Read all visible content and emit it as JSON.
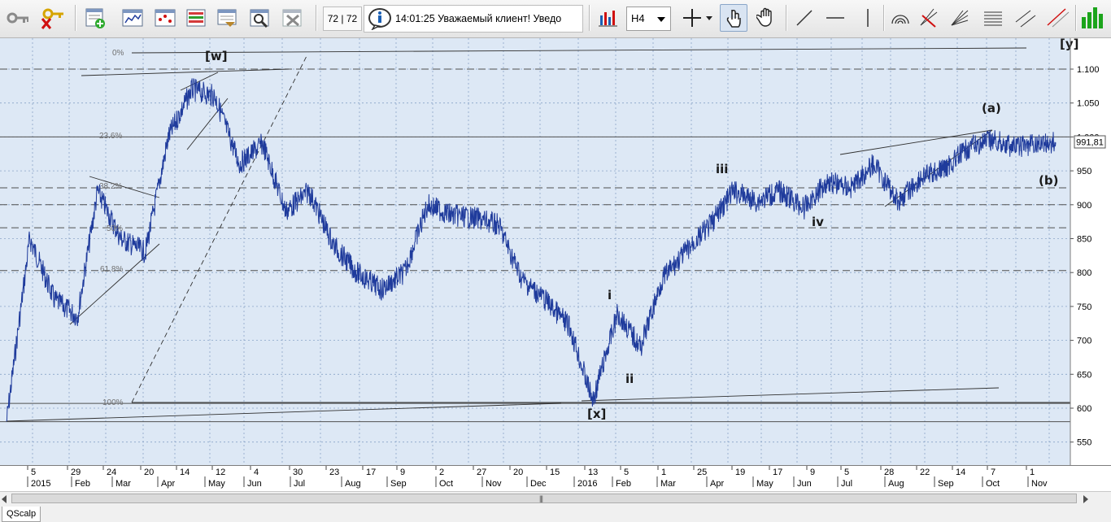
{
  "toolbar": {
    "counter": "72 | 72",
    "ticker": "14:01:25  Уважаемый клиент!  Уведо",
    "timeframe": "H4",
    "icons": [
      "key-icon",
      "key-delete-icon",
      "add-chart-icon",
      "bars-icon",
      "chart-points-icon",
      "table-icon",
      "deal-icon",
      "search-edit-icon",
      "remove-icon",
      "info-icon",
      "indicator-icon",
      "crosshair-icon",
      "hand-pointer-icon",
      "hand-drag-icon",
      "trend-line-icon",
      "horizontal-line-icon",
      "vertical-line-icon",
      "arc-icon",
      "pitchfork-icon",
      "fan-icon",
      "fibo-levels-icon",
      "channel-icon",
      "volume-bars-icon"
    ]
  },
  "chart": {
    "price_label": "991,81",
    "y_ticks": [
      "1.100",
      "1.050",
      "1.000",
      "950",
      "900",
      "850",
      "800",
      "750",
      "700",
      "650",
      "600",
      "550"
    ],
    "fib_labels": [
      "0%",
      "23.6%",
      "38.2%",
      "50%",
      "61.8%",
      "100%"
    ],
    "wave_labels": [
      "[w]",
      "[x]",
      "[y]",
      "(a)",
      "(b)",
      "i",
      "ii",
      "iii",
      "iv"
    ],
    "day_labels": [
      "5",
      "29",
      "24",
      "20",
      "14",
      "12",
      "4",
      "30",
      "23",
      "17",
      "9",
      "2",
      "27",
      "20",
      "15",
      "13",
      "5",
      "1",
      "25",
      "19",
      "17",
      "9",
      "5",
      "28",
      "22",
      "14",
      "7",
      "1"
    ],
    "month_labels": [
      "2015",
      "Feb",
      "Mar",
      "Apr",
      "May",
      "Jun",
      "Jul",
      "Aug",
      "Sep",
      "Oct",
      "Nov",
      "Dec",
      "2016",
      "Feb",
      "Mar",
      "Apr",
      "May",
      "Jun",
      "Jul",
      "Aug",
      "Sep",
      "Oct",
      "Nov"
    ],
    "colors": {
      "background": "#dde8f5",
      "series": "#1f3b9c",
      "grid": "#8aa4c8",
      "levels": "#555555"
    }
  },
  "chart_data": {
    "type": "line",
    "title": "",
    "timeframe": "H4",
    "ylim": [
      525,
      1130
    ],
    "last_value": 991.81,
    "x": [
      "2015-01-05",
      "2015-01-20",
      "2015-02-05",
      "2015-02-20",
      "2015-03-05",
      "2015-03-20",
      "2015-04-05",
      "2015-04-20",
      "2015-05-05",
      "2015-05-20",
      "2015-06-05",
      "2015-06-20",
      "2015-07-05",
      "2015-07-20",
      "2015-08-05",
      "2015-08-20",
      "2015-09-05",
      "2015-09-20",
      "2015-10-05",
      "2015-10-20",
      "2015-11-05",
      "2015-11-20",
      "2015-12-05",
      "2015-12-20",
      "2016-01-05",
      "2016-01-20",
      "2016-02-05",
      "2016-02-20",
      "2016-03-05",
      "2016-03-20",
      "2016-04-05",
      "2016-04-20",
      "2016-05-05",
      "2016-05-20",
      "2016-06-05",
      "2016-06-20",
      "2016-07-05",
      "2016-07-20",
      "2016-08-05",
      "2016-08-20",
      "2016-09-05",
      "2016-09-20",
      "2016-10-05",
      "2016-10-20",
      "2016-11-05",
      "2016-11-15"
    ],
    "values": [
      580,
      850,
      760,
      735,
      920,
      850,
      830,
      1000,
      1070,
      1060,
      960,
      990,
      890,
      920,
      840,
      800,
      775,
      800,
      900,
      885,
      880,
      870,
      790,
      760,
      720,
      610,
      740,
      690,
      790,
      830,
      870,
      920,
      905,
      920,
      895,
      935,
      925,
      960,
      905,
      940,
      955,
      985,
      995,
      985,
      990,
      991.81
    ],
    "horizontal_levels": [
      1100,
      1000,
      925,
      900,
      866,
      803,
      607,
      580
    ],
    "fib_levels": {
      "0%": 1100,
      "23.6%": 1000,
      "38.2%": 925,
      "50%": 866,
      "61.8%": 803,
      "100%": 607
    }
  }
}
